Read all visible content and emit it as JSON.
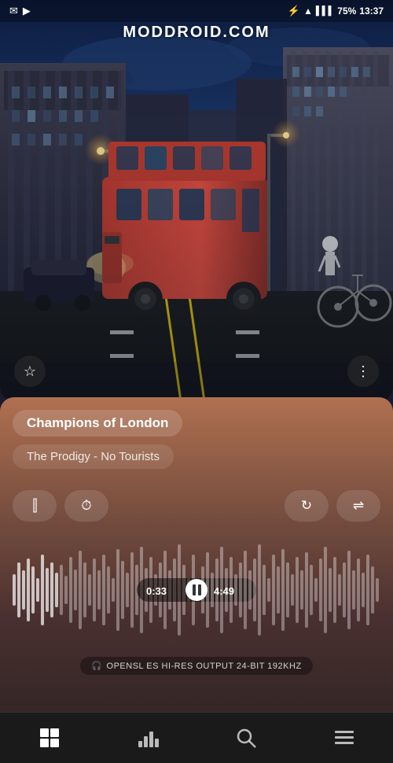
{
  "statusBar": {
    "leftIcons": [
      "✉",
      "▶"
    ],
    "bluetooth": "⬡",
    "wifi": "wifi",
    "signal": "signal",
    "battery": "75%",
    "time": "13:37"
  },
  "watermark": "MODDROID.COM",
  "albumArt": {
    "starIcon": "☆",
    "moreIcon": "⋮"
  },
  "songInfo": {
    "title": "Champions of London",
    "album": "The Prodigy - No Tourists"
  },
  "controls": {
    "equalizerIcon": "≋",
    "clockIcon": "⏱",
    "repeatIcon": "🔁",
    "shuffleIcon": "⇌"
  },
  "player": {
    "currentTime": "0:33",
    "totalTime": "4:49",
    "pauseIcon": "⏸"
  },
  "audioOutput": {
    "headphoneIcon": "🎧",
    "label": "OPENSL ES HI-RES OUTPUT 24-BIT 192KHZ"
  },
  "bottomNav": {
    "gridIcon": "⊞",
    "barsIcon": "▋",
    "searchIcon": "🔍",
    "menuIcon": "≡"
  }
}
